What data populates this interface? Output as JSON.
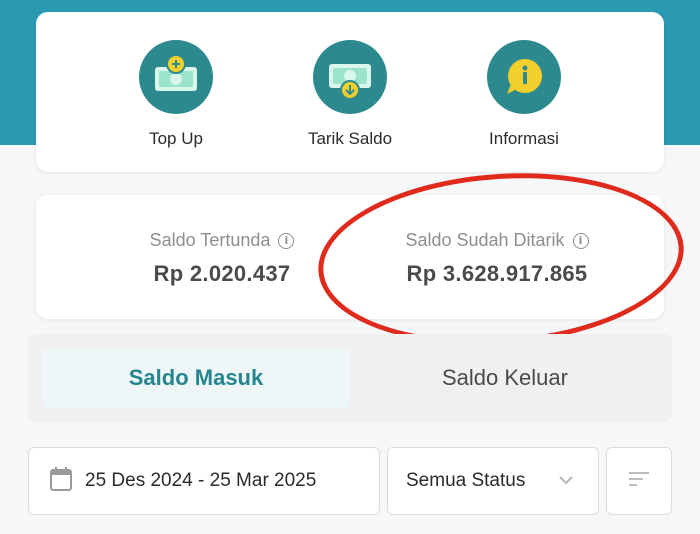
{
  "actions": [
    {
      "label": "Top Up",
      "icon": "top-up-icon"
    },
    {
      "label": "Tarik Saldo",
      "icon": "withdraw-icon"
    },
    {
      "label": "Informasi",
      "icon": "info-icon"
    }
  ],
  "balances": {
    "pending_label": "Saldo Tertunda",
    "pending_value": "Rp 2.020.437",
    "withdrawn_label": "Saldo Sudah Ditarik",
    "withdrawn_value": "Rp 3.628.917.865"
  },
  "tabs": {
    "active": "Saldo Masuk",
    "inactive": "Saldo Keluar"
  },
  "filters": {
    "date_range": "25 Des 2024 - 25 Mar 2025",
    "status": "Semua Status"
  },
  "colors": {
    "brand_teal": "#2a9ab3",
    "icon_circle": "#2c8a8f",
    "icon_yellow": "#f2cf2a",
    "annotation_red": "#e02a1c"
  }
}
